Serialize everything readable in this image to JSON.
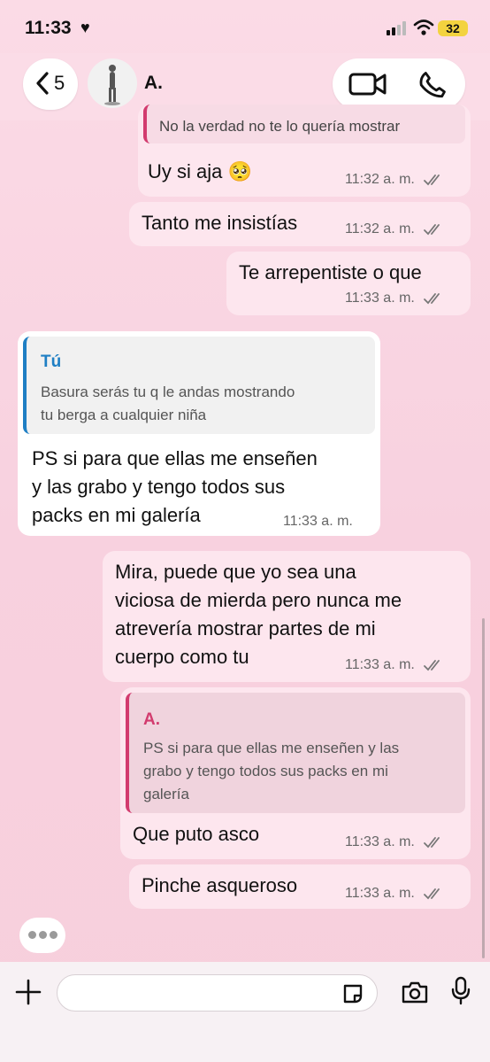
{
  "status_bar": {
    "time": "11:33",
    "battery": "32"
  },
  "header": {
    "back_count": "5",
    "contact_name": "A."
  },
  "messages": {
    "m1": {
      "quoted_text": "No la verdad no te lo quería mostrar",
      "text": "Uy si aja 🥺",
      "time": "11:32 a. m."
    },
    "m2": {
      "text": "Tanto me insistías",
      "time": "11:32 a. m."
    },
    "m3": {
      "text": "Te arrepentiste o que",
      "time": "11:33 a. m."
    },
    "m4": {
      "quote_author": "Tú",
      "quote_lines": [
        "Basura serás tu q le andas mostrando",
        "tu berga a cualquier niña"
      ],
      "lines": [
        "PS si para que ellas me enseñen",
        "y las grabo y tengo todos sus",
        "packs en mi galería"
      ],
      "time": "11:33 a. m."
    },
    "m5": {
      "lines": [
        "Mira, puede que yo sea una",
        "viciosa de mierda pero nunca me",
        "atrevería mostrar partes de mi",
        "cuerpo como tu"
      ],
      "time": "11:33 a. m."
    },
    "m6": {
      "quote_author": "A.",
      "quote_lines": [
        "PS si para que ellas me enseñen y las",
        "grabo y tengo todos sus packs en mi",
        "galería"
      ],
      "text": "Que puto asco",
      "time": "11:33 a. m."
    },
    "m7": {
      "text": "Pinche asqueroso",
      "time": "11:33 a. m."
    }
  },
  "colors": {
    "reply_accent_in": "#1f7fc4",
    "reply_accent_out": "#d23b6e",
    "outgoing_bubble": "#fde6ee"
  },
  "icons": [
    "heart-icon",
    "signal-icon",
    "wifi-icon",
    "chevron-left-icon",
    "video-call-icon",
    "phone-icon",
    "double-check-icon",
    "plus-icon",
    "sticker-icon",
    "camera-icon",
    "microphone-icon"
  ]
}
